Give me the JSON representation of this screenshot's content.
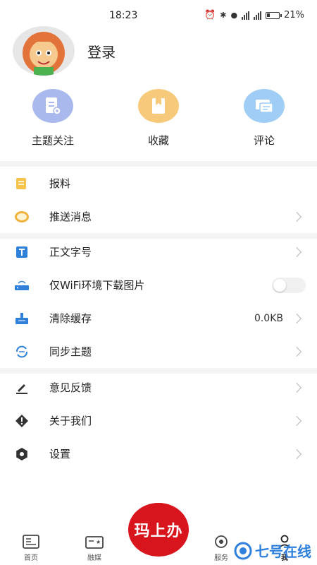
{
  "status_bar": {
    "time": "18:23",
    "battery_percent": "21%"
  },
  "profile": {
    "login_label": "登录"
  },
  "quick_actions": [
    {
      "label": "主题关注",
      "icon": "theme-follow-icon",
      "color": "#a9b9ee"
    },
    {
      "label": "收藏",
      "icon": "bookmark-icon",
      "color": "#f7c97a"
    },
    {
      "label": "评论",
      "icon": "comment-icon",
      "color": "#9fcdf5"
    }
  ],
  "menu": {
    "report": "报料",
    "push": "推送消息",
    "font_size": "正文字号",
    "wifi_images": "仅WiFi环境下载图片",
    "wifi_images_enabled": false,
    "clear_cache": "清除缓存",
    "cache_size": "0.0KB",
    "sync_topics": "同步主题",
    "feedback": "意见反馈",
    "about": "关于我们",
    "settings": "设置"
  },
  "bottom_nav": {
    "home": "首页",
    "media": "融媒",
    "center_logo": "玛上办",
    "service": "服务",
    "me": "我"
  },
  "watermark": "七号在线",
  "colors": {
    "accent_red": "#d8141c",
    "watermark_blue": "#2f7fdc"
  }
}
